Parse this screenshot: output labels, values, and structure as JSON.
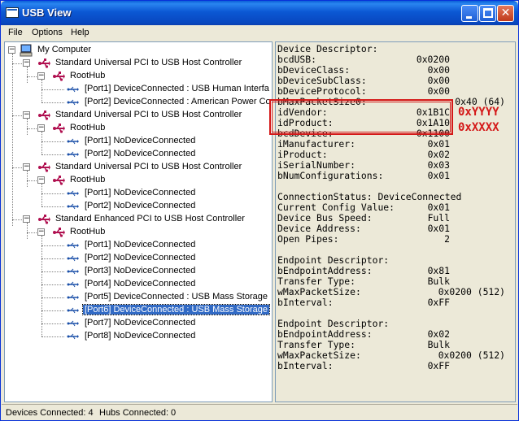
{
  "window": {
    "title": "USB View"
  },
  "menu": {
    "items": [
      "File",
      "Options",
      "Help"
    ]
  },
  "tree": {
    "root": "My Computer",
    "controllers": [
      {
        "label": "Standard Universal PCI to USB Host Controller",
        "hub": "RootHub",
        "ports": [
          "[Port1] DeviceConnected :  USB Human Interfa",
          "[Port2] DeviceConnected :  American Power Co"
        ]
      },
      {
        "label": "Standard Universal PCI to USB Host Controller",
        "hub": "RootHub",
        "ports": [
          "[Port1] NoDeviceConnected",
          "[Port2] NoDeviceConnected"
        ]
      },
      {
        "label": "Standard Universal PCI to USB Host Controller",
        "hub": "RootHub",
        "ports": [
          "[Port1] NoDeviceConnected",
          "[Port2] NoDeviceConnected"
        ]
      },
      {
        "label": "Standard Enhanced PCI to USB Host Controller",
        "hub": "RootHub",
        "ports": [
          "[Port1] NoDeviceConnected",
          "[Port2] NoDeviceConnected",
          "[Port3] NoDeviceConnected",
          "[Port4] NoDeviceConnected",
          "[Port5] DeviceConnected :  USB Mass Storage",
          "[Port6] DeviceConnected :  USB Mass Storage",
          "[Port7] NoDeviceConnected",
          "[Port8] NoDeviceConnected"
        ]
      }
    ],
    "selected": "[Port6] DeviceConnected :  USB Mass Storage"
  },
  "details": {
    "rows": [
      [
        "Device Descriptor:",
        ""
      ],
      [
        "bcdUSB:",
        "0x0200"
      ],
      [
        "bDeviceClass:",
        "0x00"
      ],
      [
        "bDeviceSubClass:",
        "0x00"
      ],
      [
        "bDeviceProtocol:",
        "0x00"
      ],
      [
        "bMaxPacketSize0:",
        "0x40 (64)"
      ],
      [
        "idVendor:",
        "0x1B1C"
      ],
      [
        "idProduct:",
        "0x1A10"
      ],
      [
        "bcdDevice:",
        "0x1100"
      ],
      [
        "iManufacturer:",
        "0x01"
      ],
      [
        "iProduct:",
        "0x02"
      ],
      [
        "iSerialNumber:",
        "0x03"
      ],
      [
        "bNumConfigurations:",
        "0x01"
      ],
      [
        "",
        ""
      ],
      [
        "ConnectionStatus: DeviceConnected",
        ""
      ],
      [
        "Current Config Value:",
        "0x01"
      ],
      [
        "Device Bus Speed:",
        "Full"
      ],
      [
        "Device Address:",
        "0x01"
      ],
      [
        "Open Pipes:",
        "2"
      ],
      [
        "",
        ""
      ],
      [
        "Endpoint Descriptor:",
        ""
      ],
      [
        "bEndpointAddress:",
        "0x81"
      ],
      [
        "Transfer Type:",
        "Bulk"
      ],
      [
        "wMaxPacketSize:",
        "0x0200 (512)"
      ],
      [
        "bInterval:",
        "0xFF"
      ],
      [
        "",
        ""
      ],
      [
        "Endpoint Descriptor:",
        ""
      ],
      [
        "bEndpointAddress:",
        "0x02"
      ],
      [
        "Transfer Type:",
        "Bulk"
      ],
      [
        "wMaxPacketSize:",
        "0x0200 (512)"
      ],
      [
        "bInterval:",
        "0xFF"
      ]
    ]
  },
  "annotations": {
    "vendor": "0xYYYY",
    "product": "0xXXXX",
    "color": "#d41818"
  },
  "status": {
    "devices": "Devices Connected: 4",
    "hubs": "Hubs Connected: 0"
  }
}
